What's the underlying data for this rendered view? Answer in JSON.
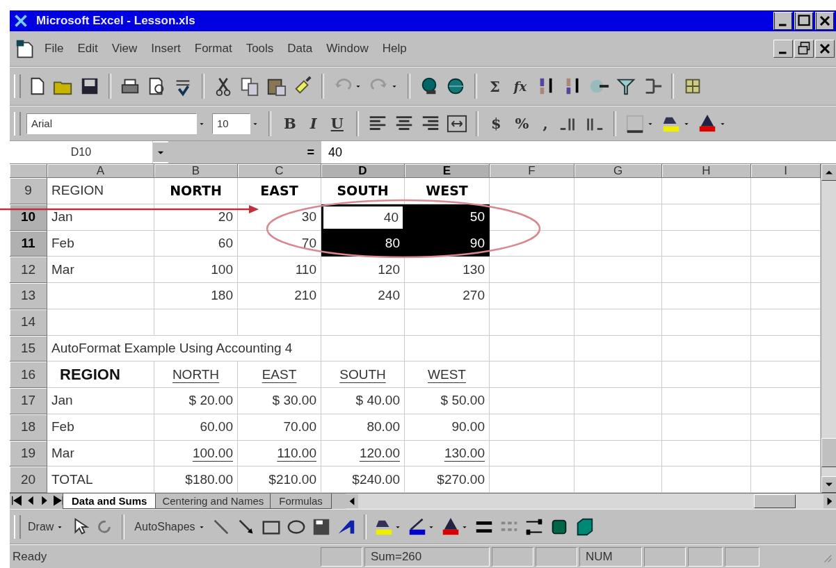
{
  "window": {
    "title": "Microsoft Excel - Lesson.xls"
  },
  "menu": [
    "File",
    "Edit",
    "View",
    "Insert",
    "Format",
    "Tools",
    "Data",
    "Window",
    "Help"
  ],
  "standard_toolbar": {
    "function_buttons": [
      "Σ",
      "fx"
    ]
  },
  "formatting_toolbar": {
    "font": "Arial",
    "size": "10",
    "style_buttons": [
      "B",
      "I",
      "U"
    ],
    "number_buttons": [
      "$",
      "%",
      ","
    ]
  },
  "formula_bar": {
    "name_box": "D10",
    "equals_button": "=",
    "value": "40"
  },
  "columns": [
    "A",
    "B",
    "C",
    "D",
    "E",
    "F",
    "G",
    "H",
    "I"
  ],
  "rows": [
    {
      "number": "9",
      "kind": "header",
      "cells": [
        {
          "text": "REGION",
          "selected": false,
          "active": false
        },
        {
          "text": "NORTH",
          "selected": false,
          "active": false
        },
        {
          "text": "EAST",
          "selected": false,
          "active": false
        },
        {
          "text": "SOUTH",
          "selected": false,
          "active": false
        },
        {
          "text": "WEST",
          "selected": false,
          "active": false
        }
      ]
    },
    {
      "number": "10",
      "kind": "data",
      "cells": [
        {
          "text": "Jan",
          "selected": false,
          "active": false
        },
        {
          "text": "20",
          "selected": false,
          "active": false
        },
        {
          "text": "30",
          "selected": false,
          "active": false
        },
        {
          "text": "40",
          "selected": true,
          "active": true
        },
        {
          "text": "50",
          "selected": true,
          "active": false
        }
      ]
    },
    {
      "number": "11",
      "kind": "data",
      "cells": [
        {
          "text": "Feb",
          "selected": false,
          "active": false
        },
        {
          "text": "60",
          "selected": false,
          "active": false
        },
        {
          "text": "70",
          "selected": false,
          "active": false
        },
        {
          "text": "80",
          "selected": true,
          "active": false
        },
        {
          "text": "90",
          "selected": true,
          "active": false
        }
      ]
    },
    {
      "number": "12",
      "kind": "data",
      "cells": [
        {
          "text": "Mar",
          "selected": false,
          "active": false
        },
        {
          "text": "100",
          "selected": false,
          "active": false
        },
        {
          "text": "110",
          "selected": false,
          "active": false
        },
        {
          "text": "120",
          "selected": false,
          "active": false
        },
        {
          "text": "130",
          "selected": false,
          "active": false
        }
      ]
    },
    {
      "number": "13",
      "kind": "data",
      "cells": [
        {
          "selected": false,
          "active": false
        },
        {
          "text": "180",
          "selected": false,
          "active": false
        },
        {
          "text": "210",
          "selected": false,
          "active": false
        },
        {
          "text": "240",
          "selected": false,
          "active": false
        },
        {
          "text": "270",
          "selected": false,
          "active": false
        }
      ]
    },
    {
      "number": "14",
      "kind": "data",
      "cells": []
    },
    {
      "number": "15",
      "kind": "title",
      "cells": [
        {
          "text": "AutoFormat Example Using Accounting 4",
          "selected": false,
          "active": false
        }
      ]
    },
    {
      "number": "16",
      "kind": "accounting_header",
      "cells": [
        {
          "text": "REGION",
          "selected": false,
          "active": false
        },
        {
          "text": "NORTH",
          "selected": false,
          "active": false
        },
        {
          "text": "EAST",
          "selected": false,
          "active": false
        },
        {
          "text": "SOUTH",
          "selected": false,
          "active": false
        },
        {
          "text": "WEST",
          "selected": false,
          "active": false
        }
      ]
    },
    {
      "number": "17",
      "kind": "accounting",
      "cells": [
        {
          "text": "Jan",
          "selected": false,
          "active": false
        },
        {
          "text": "$ 20.00",
          "selected": false,
          "active": false
        },
        {
          "text": "$ 30.00",
          "selected": false,
          "active": false
        },
        {
          "text": "$ 40.00",
          "selected": false,
          "active": false
        },
        {
          "text": "$ 50.00",
          "selected": false,
          "active": false
        }
      ]
    },
    {
      "number": "18",
      "kind": "accounting",
      "cells": [
        {
          "text": "Feb",
          "selected": false,
          "active": false
        },
        {
          "text": "60.00",
          "selected": false,
          "active": false
        },
        {
          "text": "70.00",
          "selected": false,
          "active": false
        },
        {
          "text": "80.00",
          "selected": false,
          "active": false
        },
        {
          "text": "90.00",
          "selected": false,
          "active": false
        }
      ]
    },
    {
      "number": "19",
      "kind": "accounting_last",
      "cells": [
        {
          "text": "Mar",
          "selected": false,
          "active": false
        },
        {
          "text": "100.00",
          "selected": false,
          "active": false
        },
        {
          "text": "110.00",
          "selected": false,
          "active": false
        },
        {
          "text": "120.00",
          "selected": false,
          "active": false
        },
        {
          "text": "130.00",
          "selected": false,
          "active": false
        }
      ]
    },
    {
      "number": "20",
      "kind": "accounting",
      "cells": [
        {
          "text": "TOTAL",
          "selected": false,
          "active": false
        },
        {
          "text": "$180.00",
          "selected": false,
          "active": false
        },
        {
          "text": "$210.00",
          "selected": false,
          "active": false
        },
        {
          "text": "$240.00",
          "selected": false,
          "active": false
        },
        {
          "text": "$270.00",
          "selected": false,
          "active": false
        }
      ]
    }
  ],
  "sheet_tabs": [
    {
      "label": "Data and Sums",
      "selected": true
    },
    {
      "label": "Centering and Names",
      "selected": false
    },
    {
      "label": "Formulas",
      "selected": false
    }
  ],
  "drawing_toolbar": {
    "draw_menu": "Draw",
    "autoshapes_menu": "AutoShapes"
  },
  "status_bar": {
    "mode": "Ready",
    "sum": "Sum=260",
    "num_lock": "NUM"
  }
}
